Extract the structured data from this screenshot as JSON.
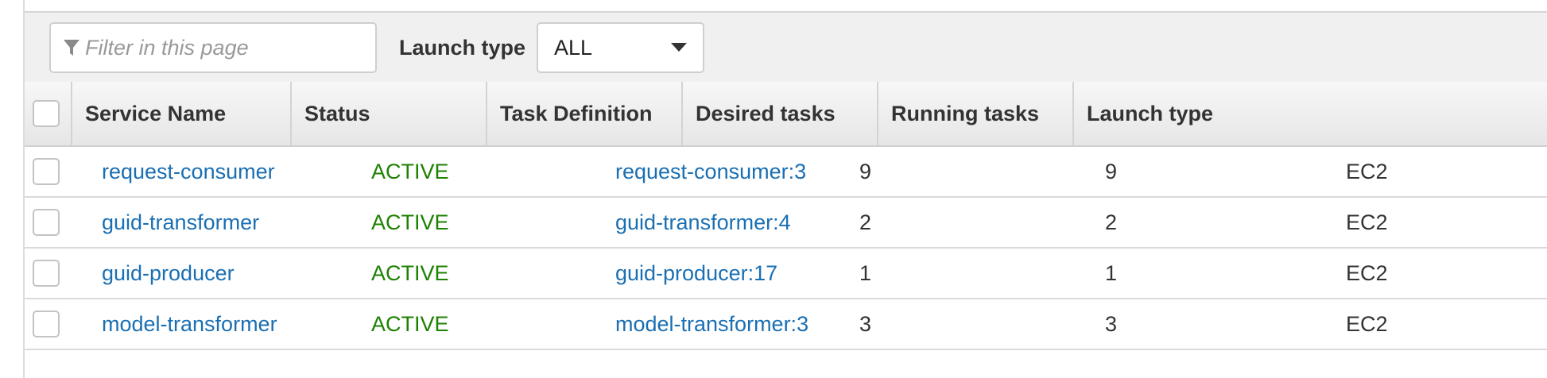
{
  "toolbar": {
    "filter_placeholder": "Filter in this page",
    "filter_icon": "filter-icon",
    "launch_type_label": "Launch type",
    "launch_type_value": "ALL"
  },
  "table": {
    "columns": [
      "Service Name",
      "Status",
      "Task Definition",
      "Desired tasks",
      "Running tasks",
      "Launch type"
    ],
    "rows": [
      {
        "service": "request-consumer",
        "status": "ACTIVE",
        "task_definition": "request-consumer:3",
        "desired": "9",
        "running": "9",
        "launch_type": "EC2"
      },
      {
        "service": "guid-transformer",
        "status": "ACTIVE",
        "task_definition": "guid-transformer:4",
        "desired": "2",
        "running": "2",
        "launch_type": "EC2"
      },
      {
        "service": "guid-producer",
        "status": "ACTIVE",
        "task_definition": "guid-producer:17",
        "desired": "1",
        "running": "1",
        "launch_type": "EC2"
      },
      {
        "service": "model-transformer",
        "status": "ACTIVE",
        "task_definition": "model-transformer:3",
        "desired": "3",
        "running": "3",
        "launch_type": "EC2"
      }
    ]
  },
  "colors": {
    "link": "#1a6fb3",
    "status_active": "#1d8102",
    "toolbar_bg": "#f0f0f0"
  }
}
